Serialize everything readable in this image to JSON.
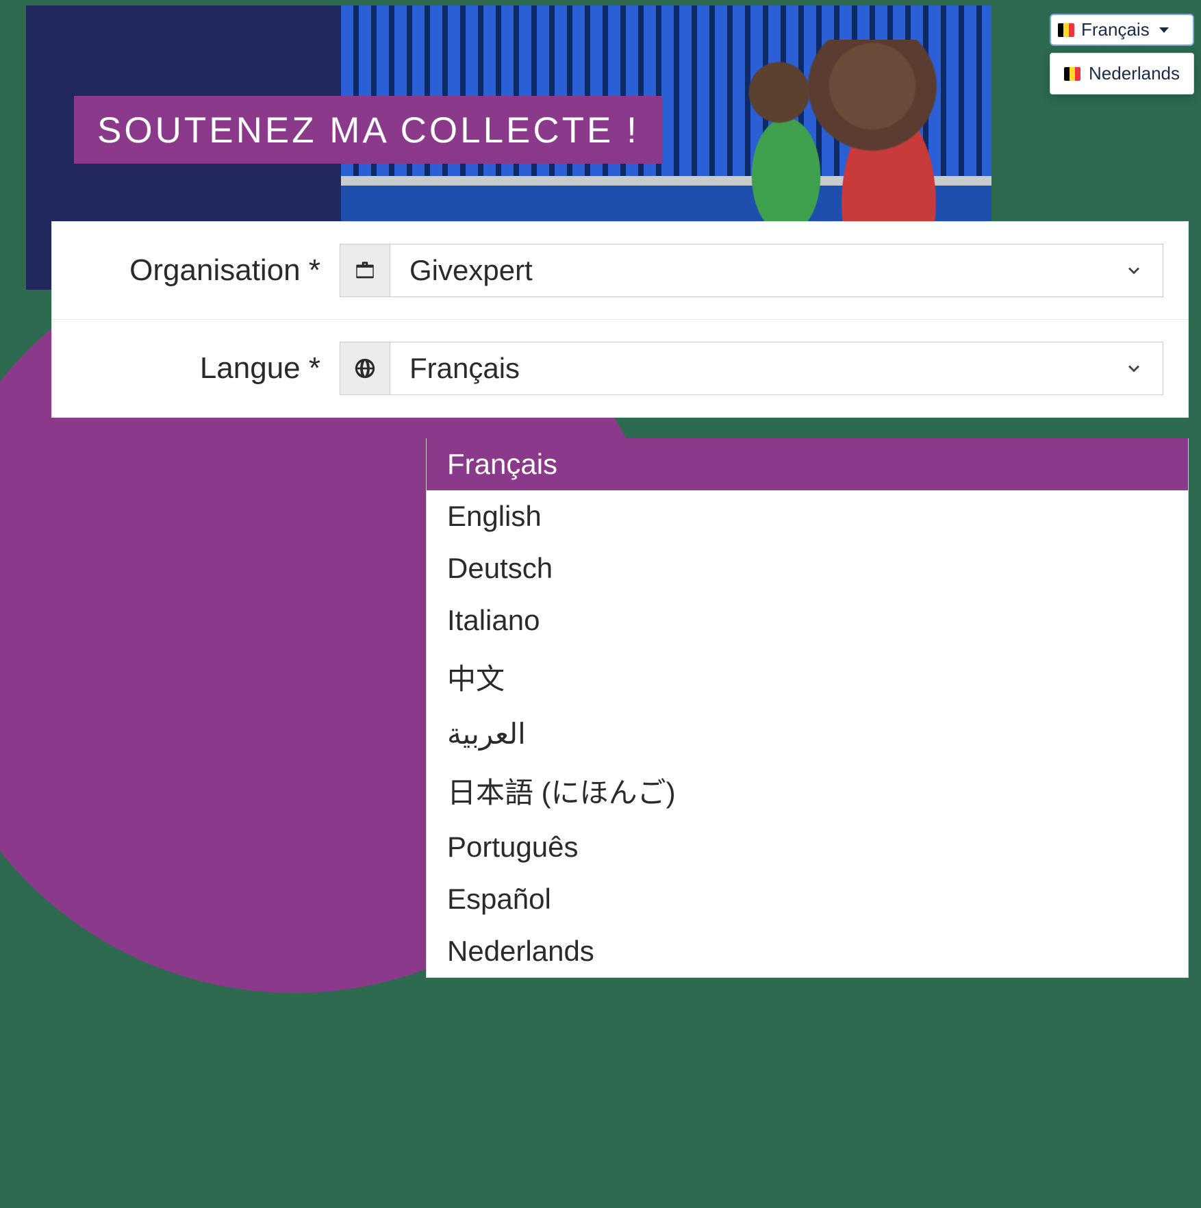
{
  "hero": {
    "title": "SOUTENEZ MA COLLECTE !"
  },
  "langPicker": {
    "current": "Français",
    "menu": [
      "Nederlands"
    ]
  },
  "form": {
    "organisation": {
      "label": "Organisation *",
      "value": "Givexpert"
    },
    "langue": {
      "label": "Langue *",
      "value": "Français",
      "options": [
        "Français",
        "English",
        "Deutsch",
        "Italiano",
        "中文",
        "العربية",
        "日本語 (にほんご)",
        "Português",
        "Español",
        "Nederlands"
      ],
      "selectedIndex": 0
    }
  }
}
